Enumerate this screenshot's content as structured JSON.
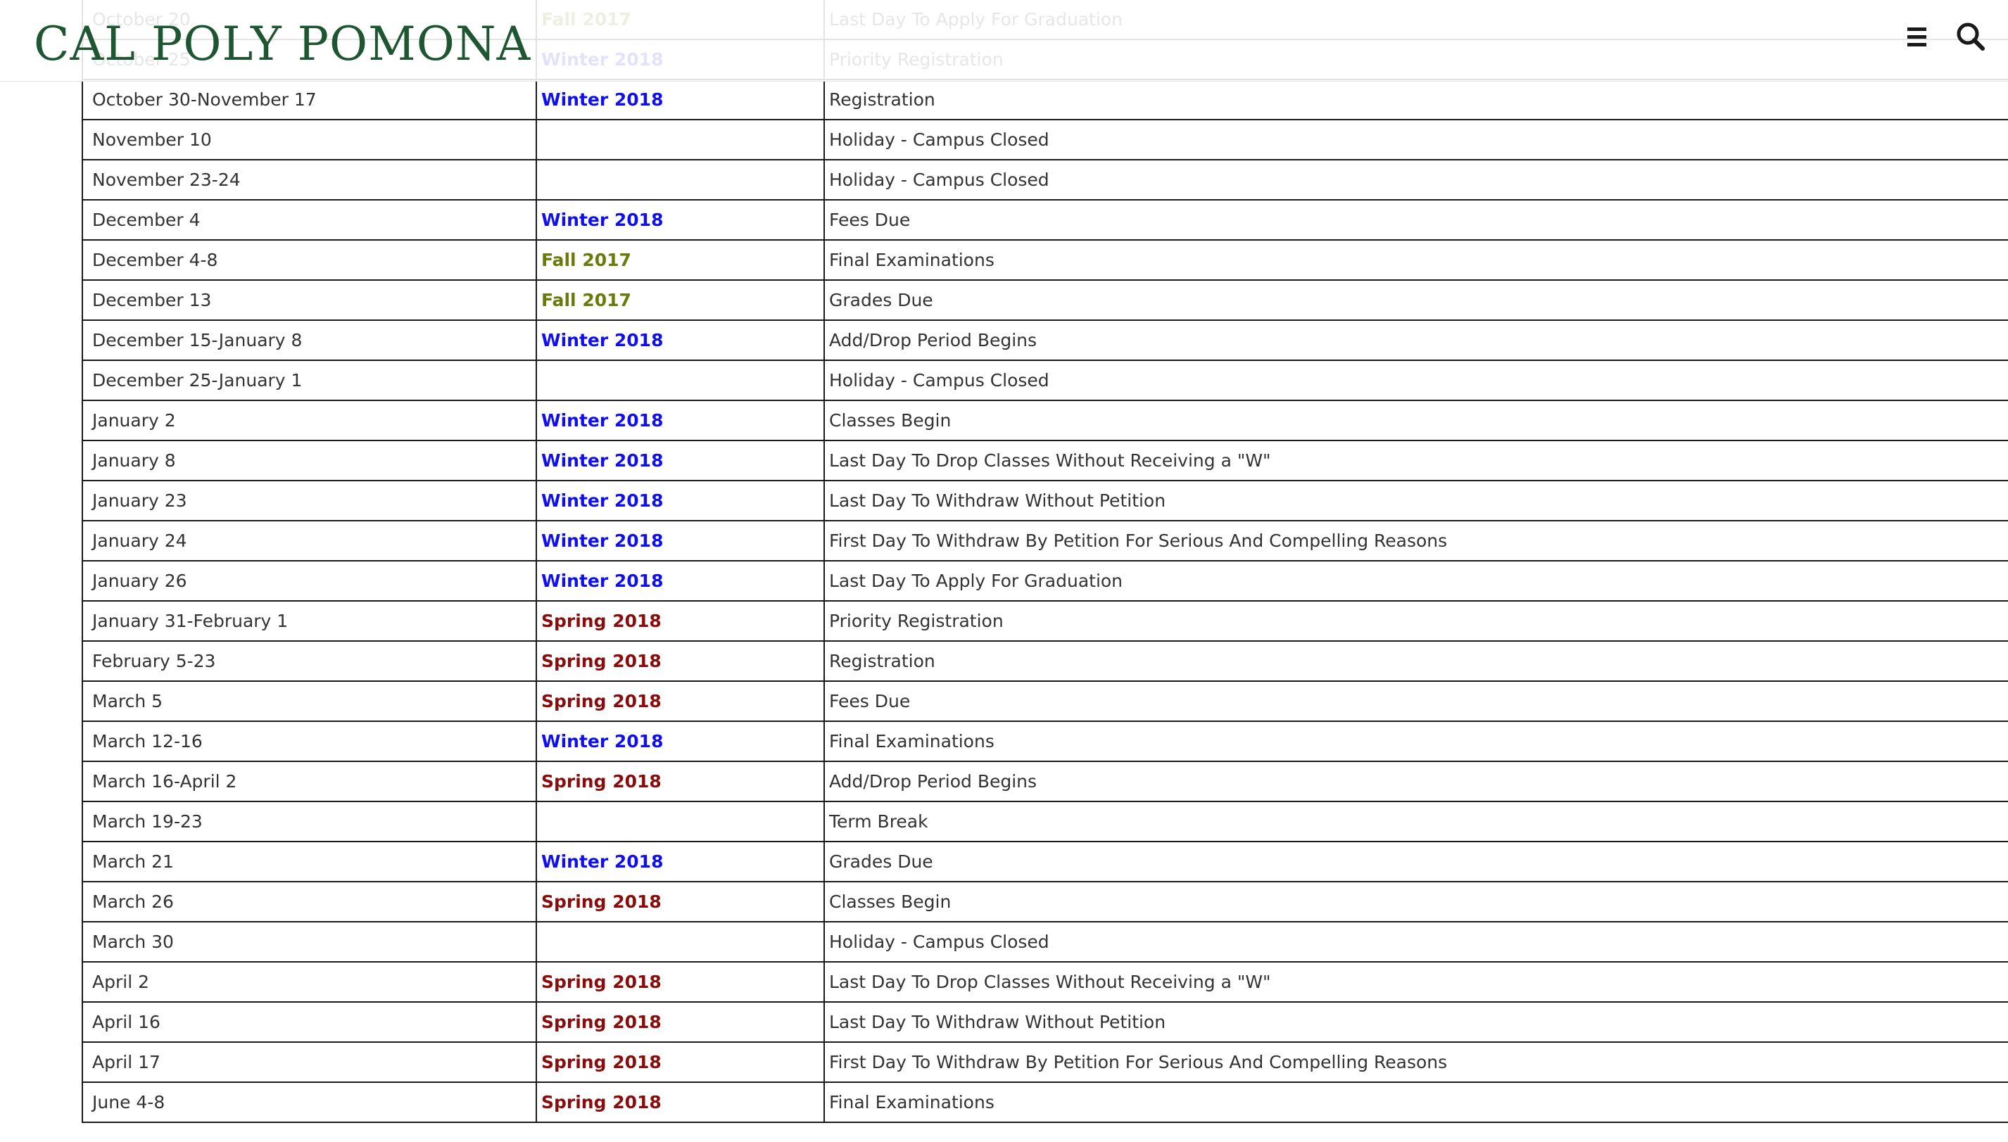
{
  "header": {
    "logo_text": "CAL POLY POMONA",
    "menu_icon": "hamburger-menu-icon",
    "search_icon": "search-icon"
  },
  "colors": {
    "brand_green": "#1e5631",
    "winter": "#1010ee",
    "fall": "#6b7a0a",
    "spring": "#8b0c0c"
  },
  "calendar": {
    "rows": [
      {
        "date": "October 20",
        "term": "Fall 2017",
        "term_class": "fall",
        "event": "Last Day To Apply For Graduation"
      },
      {
        "date": "October 25",
        "term": "Winter 2018",
        "term_class": "winter",
        "event": "Priority Registration"
      },
      {
        "date": "October 30-November 17",
        "term": "Winter 2018",
        "term_class": "winter",
        "event": "Registration"
      },
      {
        "date": "November 10",
        "term": "",
        "term_class": "",
        "event": "Holiday - Campus Closed"
      },
      {
        "date": "November 23-24",
        "term": "",
        "term_class": "",
        "event": "Holiday - Campus Closed"
      },
      {
        "date": "December 4",
        "term": "Winter 2018",
        "term_class": "winter",
        "event": "Fees Due"
      },
      {
        "date": "December 4-8",
        "term": "Fall 2017",
        "term_class": "fall",
        "event": "Final Examinations"
      },
      {
        "date": "December 13",
        "term": "Fall 2017",
        "term_class": "fall",
        "event": "Grades Due"
      },
      {
        "date": "December 15-January 8",
        "term": "Winter 2018",
        "term_class": "winter",
        "event": "Add/Drop Period Begins"
      },
      {
        "date": "December 25-January 1",
        "term": "",
        "term_class": "",
        "event": "Holiday - Campus Closed"
      },
      {
        "date": "January 2",
        "term": "Winter 2018",
        "term_class": "winter",
        "event": "Classes Begin"
      },
      {
        "date": "January 8",
        "term": "Winter 2018",
        "term_class": "winter",
        "event": "Last Day To Drop Classes Without Receiving a \"W\""
      },
      {
        "date": "January 23",
        "term": "Winter 2018",
        "term_class": "winter",
        "event": "Last Day To Withdraw Without Petition"
      },
      {
        "date": "January 24",
        "term": "Winter 2018",
        "term_class": "winter",
        "event": "First Day To Withdraw By Petition For Serious And Compelling Reasons"
      },
      {
        "date": "January 26",
        "term": "Winter 2018",
        "term_class": "winter",
        "event": "Last Day To Apply For Graduation"
      },
      {
        "date": "January 31-February 1",
        "term": "Spring 2018",
        "term_class": "spring",
        "event": "Priority Registration"
      },
      {
        "date": "February 5-23",
        "term": "Spring 2018",
        "term_class": "spring",
        "event": "Registration"
      },
      {
        "date": "March 5",
        "term": "Spring 2018",
        "term_class": "spring",
        "event": "Fees Due"
      },
      {
        "date": "March 12-16",
        "term": "Winter 2018",
        "term_class": "winter",
        "event": "Final Examinations"
      },
      {
        "date": "March 16-April 2",
        "term": "Spring 2018",
        "term_class": "spring",
        "event": "Add/Drop Period Begins"
      },
      {
        "date": "March 19-23",
        "term": "",
        "term_class": "",
        "event": "Term Break"
      },
      {
        "date": "March 21",
        "term": "Winter 2018",
        "term_class": "winter",
        "event": "Grades Due"
      },
      {
        "date": "March 26",
        "term": "Spring 2018",
        "term_class": "spring",
        "event": "Classes Begin"
      },
      {
        "date": "March 30",
        "term": "",
        "term_class": "",
        "event": "Holiday - Campus Closed"
      },
      {
        "date": "April 2",
        "term": "Spring 2018",
        "term_class": "spring",
        "event": "Last Day To Drop Classes Without Receiving a \"W\""
      },
      {
        "date": "April 16",
        "term": "Spring 2018",
        "term_class": "spring",
        "event": "Last Day To Withdraw Without Petition"
      },
      {
        "date": "April 17",
        "term": "Spring 2018",
        "term_class": "spring",
        "event": "First Day To Withdraw By Petition For Serious And Compelling Reasons"
      },
      {
        "date": "June 4-8",
        "term": "Spring 2018",
        "term_class": "spring",
        "event": "Final Examinations"
      }
    ]
  }
}
